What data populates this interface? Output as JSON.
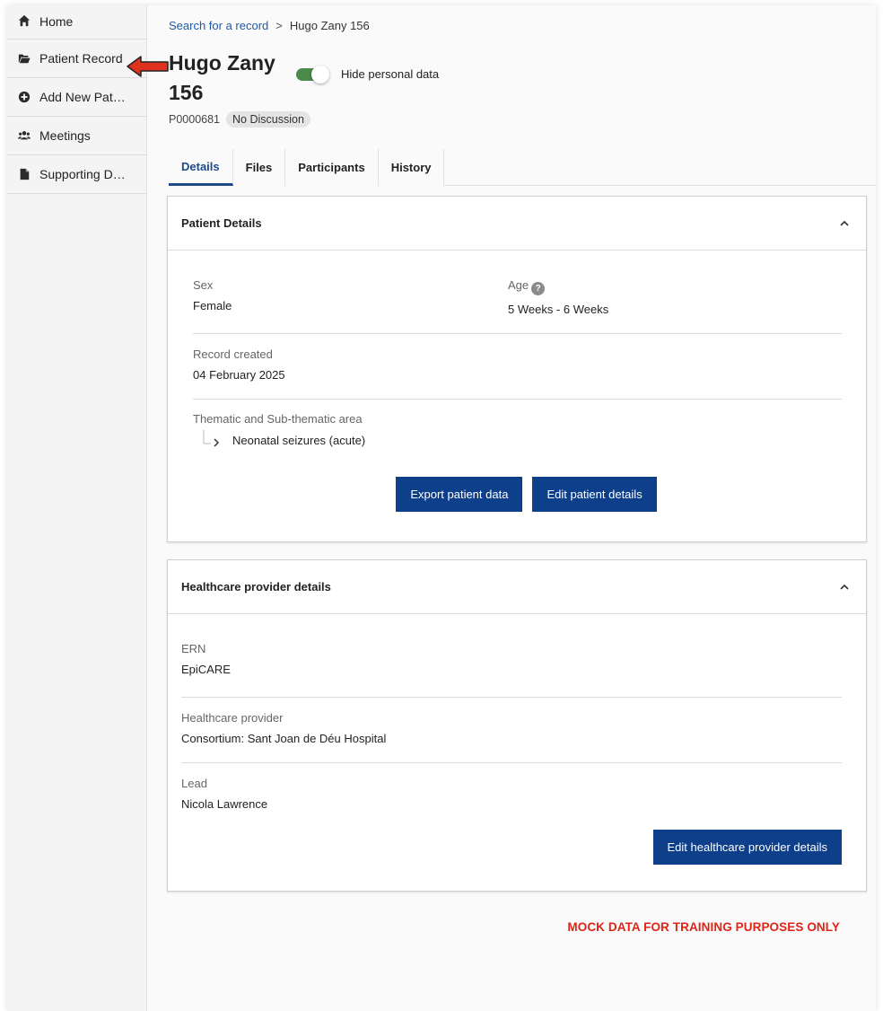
{
  "sidebar": {
    "items": [
      {
        "label": "Home",
        "icon": "home-icon"
      },
      {
        "label": "Patient Record",
        "icon": "folder-open-icon"
      },
      {
        "label": "Add New Pat…",
        "icon": "plus-circle-icon"
      },
      {
        "label": "Meetings",
        "icon": "users-icon"
      },
      {
        "label": "Supporting D…",
        "icon": "file-icon"
      }
    ]
  },
  "breadcrumb": {
    "link": "Search for a record",
    "separator": ">",
    "current": "Hugo Zany 156"
  },
  "patient": {
    "name_line1": "Hugo Zany",
    "name_line2": "156",
    "id": "P0000681",
    "status_badge": "No Discussion",
    "hide_personal_label": "Hide personal data",
    "hide_personal_on": true
  },
  "tabs": [
    {
      "label": "Details",
      "active": true
    },
    {
      "label": "Files",
      "active": false
    },
    {
      "label": "Participants",
      "active": false
    },
    {
      "label": "History",
      "active": false
    }
  ],
  "patient_details": {
    "title": "Patient Details",
    "sex_label": "Sex",
    "sex_value": "Female",
    "age_label": "Age",
    "age_help": "?",
    "age_value": "5 Weeks - 6 Weeks",
    "created_label": "Record created",
    "created_value": "04 February 2025",
    "thematic_label": "Thematic and Sub-thematic area",
    "thematic_value": "Neonatal seizures (acute)",
    "export_button": "Export patient data",
    "edit_button": "Edit patient details"
  },
  "provider_details": {
    "title": "Healthcare provider details",
    "ern_label": "ERN",
    "ern_value": "EpiCARE",
    "provider_label": "Healthcare provider",
    "provider_value": "Consortium: Sant Joan de Déu Hospital",
    "lead_label": "Lead",
    "lead_value": "Nicola Lawrence",
    "edit_button": "Edit healthcare provider details"
  },
  "footer_note": "MOCK DATA FOR TRAINING PURPOSES ONLY",
  "colors": {
    "primary_button": "#0d3f8a",
    "link": "#1e5aa8",
    "toggle_on": "#4a8a4a",
    "warning_text": "#e02416",
    "annotation_arrow": "#e0301e"
  }
}
